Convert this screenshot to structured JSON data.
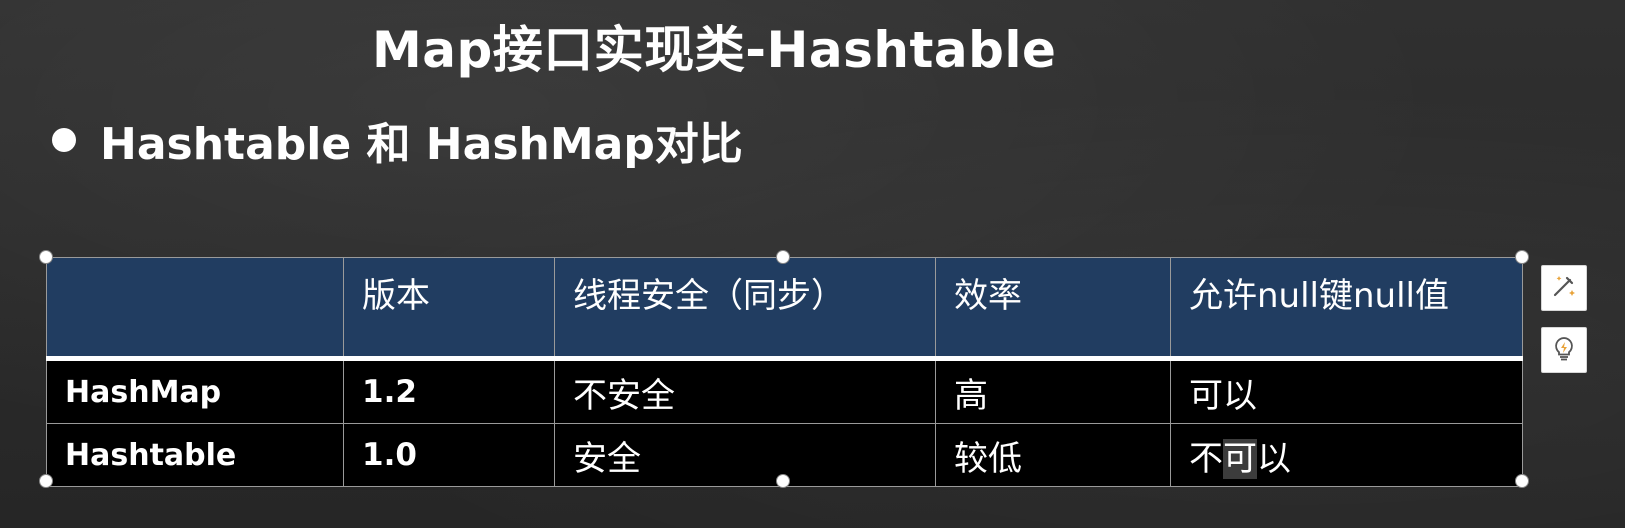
{
  "slide": {
    "title": "Map接口实现类-Hashtable",
    "bullet": "Hashtable 和 HashMap对比"
  },
  "table": {
    "headers": [
      "",
      "版本",
      "线程安全（同步）",
      "效率",
      "允许null键null值"
    ],
    "rows": [
      {
        "name": "HashMap",
        "version": "1.2",
        "thread_safe": "不安全",
        "efficiency": "高",
        "null_allowed": "可以"
      },
      {
        "name": "Hashtable",
        "version": "1.0",
        "thread_safe": "安全",
        "efficiency": "较低",
        "null_allowed_parts": [
          "不",
          "可",
          "以"
        ]
      }
    ]
  },
  "side_buttons": [
    {
      "icon": "magic-wand-icon"
    },
    {
      "icon": "lightbulb-icon"
    }
  ]
}
